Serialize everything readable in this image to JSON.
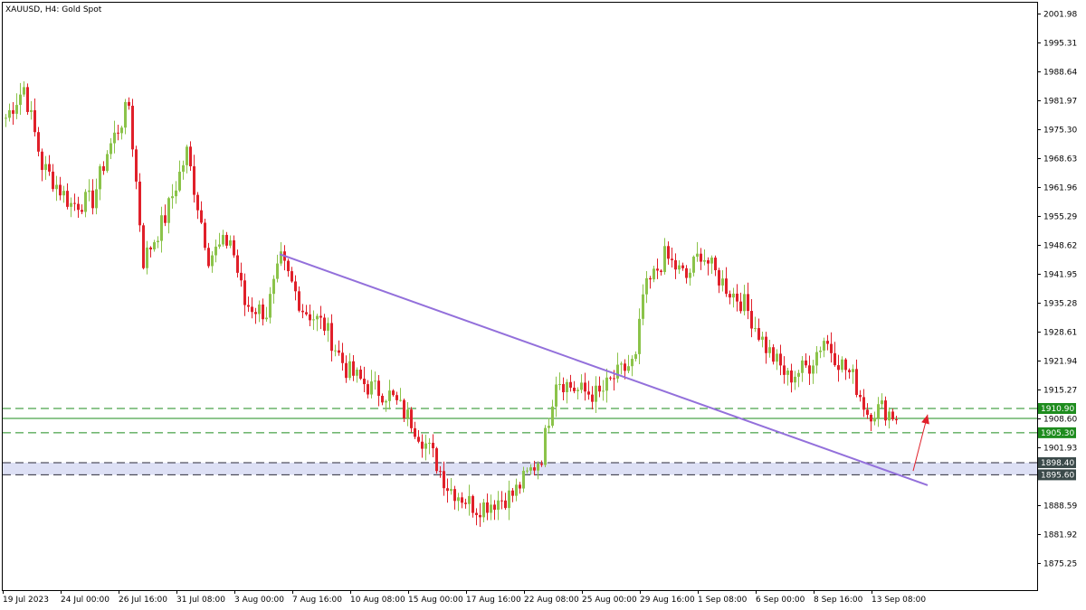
{
  "header": {
    "symbol": "XAUUSD",
    "timeframe": "H4:",
    "description": "Gold Spot"
  },
  "colors": {
    "bull": "#8bc34a",
    "bear": "#e0202a",
    "trendline": "#9370db",
    "support_line": "#1e8c1e",
    "zone_fill": "#dde0f5",
    "zone_line": "#2a2a3a",
    "tag_green": "#1e8c1e",
    "tag_dark": "#3b4a4a",
    "arrow": "#e0202a"
  },
  "chart_data": {
    "type": "candlestick",
    "ylim": [
      1869.0,
      2004.5
    ],
    "y_ticks": [
      "2001.98",
      "1995.31",
      "1988.64",
      "1981.97",
      "1975.30",
      "1968.63",
      "1961.96",
      "1955.29",
      "1948.62",
      "1941.95",
      "1935.28",
      "1928.61",
      "1921.94",
      "1915.27",
      "1908.60",
      "1901.93",
      "1888.59",
      "1881.92",
      "1875.25"
    ],
    "x_labels": [
      "19 Jul 2023",
      "24 Jul 00:00",
      "26 Jul 16:00",
      "31 Jul 08:00",
      "3 Aug 00:00",
      "7 Aug 16:00",
      "10 Aug 08:00",
      "15 Aug 00:00",
      "17 Aug 16:00",
      "22 Aug 08:00",
      "25 Aug 00:00",
      "29 Aug 16:00",
      "1 Sep 08:00",
      "6 Sep 00:00",
      "8 Sep 16:00",
      "13 Sep 08:00"
    ],
    "levels": [
      {
        "price": "1910.90",
        "value": 1910.9,
        "style": "dashed",
        "tag": "green"
      },
      {
        "price": "1908.60",
        "value": 1908.6,
        "style": "solid",
        "tag": "none"
      },
      {
        "price": "1905.30",
        "value": 1905.3,
        "style": "dashed",
        "tag": "green"
      },
      {
        "price": "1898.40",
        "value": 1898.4,
        "style": "dashed",
        "tag": "dark"
      },
      {
        "price": "1895.60",
        "value": 1895.6,
        "style": "dashed",
        "tag": "dark"
      }
    ],
    "zone": {
      "from": 1895.6,
      "to": 1898.4
    },
    "trendline": {
      "start": {
        "bar": 76,
        "price": 1946.5
      },
      "end": {
        "bar": 255,
        "price": 1893.2
      }
    },
    "arrow": {
      "start": {
        "bar": 251,
        "price": 1896.5
      },
      "end": {
        "bar": 255,
        "price": 1909.5
      }
    },
    "waypoints": [
      [
        0,
        1978
      ],
      [
        5,
        1985
      ],
      [
        10,
        1967
      ],
      [
        18,
        1958
      ],
      [
        24,
        1959
      ],
      [
        28,
        1970
      ],
      [
        34,
        1981
      ],
      [
        38,
        1945
      ],
      [
        44,
        1955
      ],
      [
        50,
        1970
      ],
      [
        56,
        1946
      ],
      [
        62,
        1950
      ],
      [
        66,
        1935
      ],
      [
        72,
        1933
      ],
      [
        76,
        1945
      ],
      [
        82,
        1934
      ],
      [
        88,
        1930
      ],
      [
        94,
        1920
      ],
      [
        100,
        1916
      ],
      [
        106,
        1914
      ],
      [
        112,
        1908
      ],
      [
        118,
        1900
      ],
      [
        122,
        1893
      ],
      [
        130,
        1888
      ],
      [
        140,
        1891
      ],
      [
        148,
        1900
      ],
      [
        152,
        1918
      ],
      [
        158,
        1915
      ],
      [
        164,
        1914
      ],
      [
        168,
        1918
      ],
      [
        174,
        1922
      ],
      [
        176,
        1937
      ],
      [
        182,
        1946
      ],
      [
        188,
        1941
      ],
      [
        192,
        1947
      ],
      [
        196,
        1942
      ],
      [
        200,
        1938
      ],
      [
        204,
        1935
      ],
      [
        210,
        1925
      ],
      [
        216,
        1918
      ],
      [
        222,
        1921
      ],
      [
        226,
        1927
      ],
      [
        230,
        1922
      ],
      [
        234,
        1918
      ],
      [
        238,
        1910
      ],
      [
        242,
        1911
      ],
      [
        246,
        1909
      ]
    ],
    "seed": 7
  }
}
